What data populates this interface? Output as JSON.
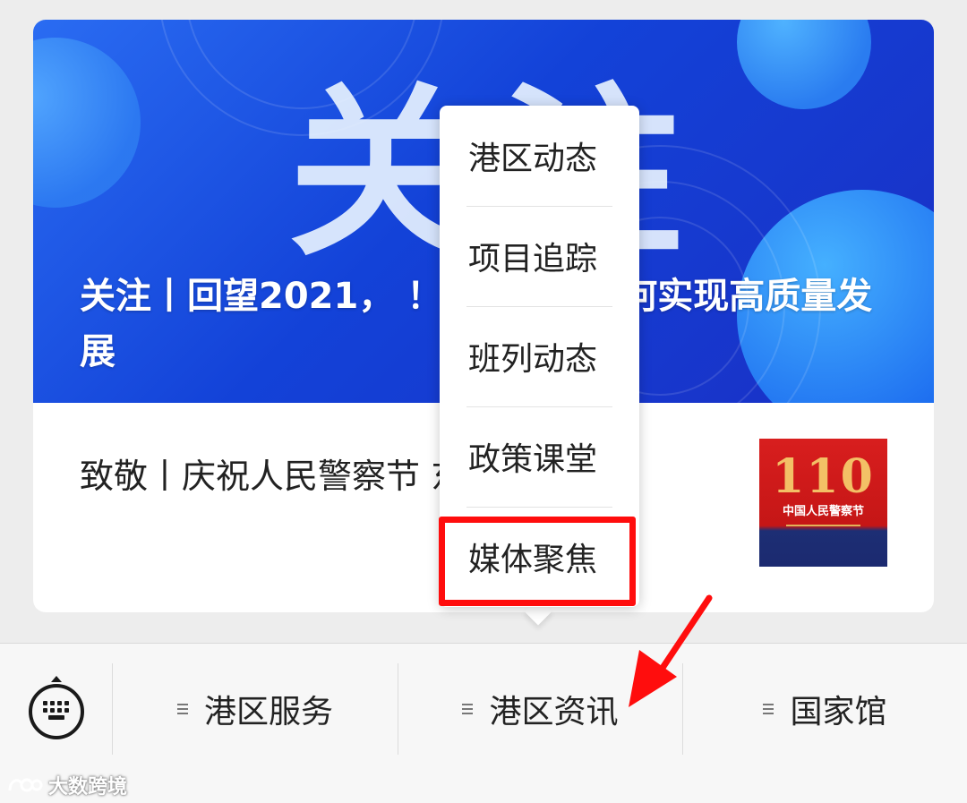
{
  "article_card": {
    "banner_title": "关注丨回望2021，              ！看铁路港如何实现高质量发展",
    "banner_bigtext": "关注",
    "second_article_title": "致敬丨庆祝人民警察节              东铁路港",
    "thumbnail": {
      "number": "110",
      "caption": "中国人民警察节"
    }
  },
  "submenu": {
    "items": [
      {
        "label": "港区动态"
      },
      {
        "label": "项目追踪"
      },
      {
        "label": "班列动态"
      },
      {
        "label": "政策课堂"
      },
      {
        "label": "媒体聚焦"
      }
    ],
    "highlighted_item": "媒体聚焦",
    "highlight_color": "#ff0d0d"
  },
  "bottom_menu": {
    "keyboard_icon": "keyboard-icon",
    "tabs": [
      {
        "label": "港区服务",
        "icon": "menu-list-icon"
      },
      {
        "label": "港区资讯",
        "icon": "menu-list-icon"
      },
      {
        "label": "国家馆",
        "icon": "menu-list-icon"
      }
    ]
  },
  "annotation": {
    "arrow_color": "#ff0d0d"
  },
  "watermark": {
    "text": "大数跨境"
  }
}
